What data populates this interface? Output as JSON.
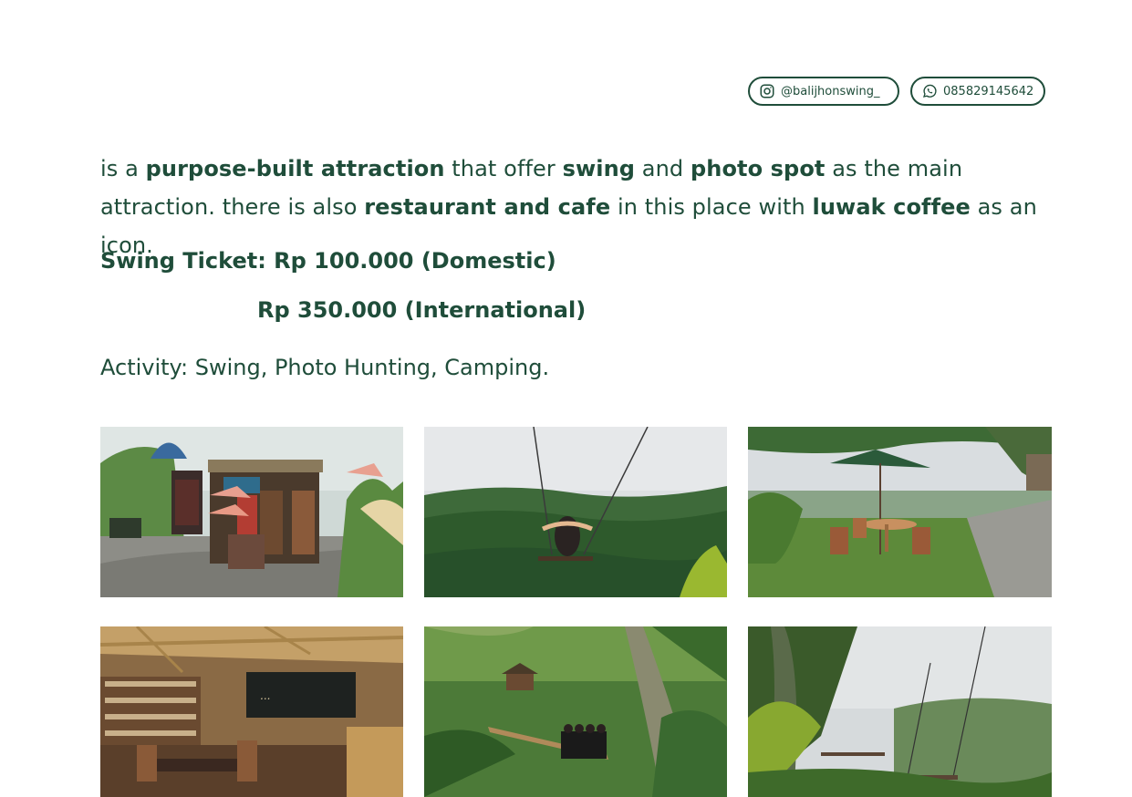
{
  "social": {
    "instagram_label": "@balijhonswing_",
    "whatsapp_label": "085829145642",
    "instagram_icon": "instagram-icon",
    "whatsapp_icon": "whatsapp-icon"
  },
  "intro": {
    "part1": "is a ",
    "bold1": "purpose-built attraction",
    "part2": " that offer ",
    "bold2": "swing",
    "part3": " and ",
    "bold3": "photo spot",
    "part4": " as the main attraction. there is also ",
    "bold4": "restaurant and cafe",
    "part5": " in this place with ",
    "bold5": "luwak coffee",
    "part6": " as an icon."
  },
  "tickets": {
    "line1": "Swing Ticket: Rp 100.000 (Domestic)",
    "line2": "Rp 350.000 (International)"
  },
  "activity": "Activity: Swing, Photo Hunting, Camping.",
  "colors": {
    "text": "#1f4d3a",
    "background": "#ffffff"
  }
}
